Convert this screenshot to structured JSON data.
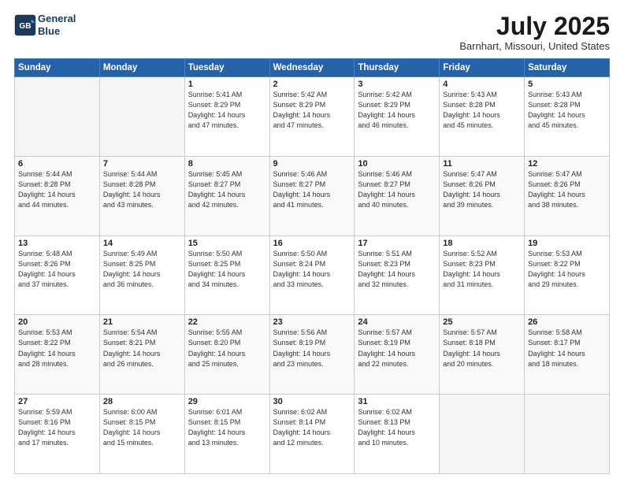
{
  "header": {
    "logo_line1": "General",
    "logo_line2": "Blue",
    "main_title": "July 2025",
    "subtitle": "Barnhart, Missouri, United States"
  },
  "weekdays": [
    "Sunday",
    "Monday",
    "Tuesday",
    "Wednesday",
    "Thursday",
    "Friday",
    "Saturday"
  ],
  "weeks": [
    [
      {
        "day": "",
        "empty": true
      },
      {
        "day": "",
        "empty": true
      },
      {
        "day": "1",
        "rise": "5:41 AM",
        "set": "8:29 PM",
        "daylight": "14 hours and 47 minutes."
      },
      {
        "day": "2",
        "rise": "5:42 AM",
        "set": "8:29 PM",
        "daylight": "14 hours and 47 minutes."
      },
      {
        "day": "3",
        "rise": "5:42 AM",
        "set": "8:29 PM",
        "daylight": "14 hours and 46 minutes."
      },
      {
        "day": "4",
        "rise": "5:43 AM",
        "set": "8:28 PM",
        "daylight": "14 hours and 45 minutes."
      },
      {
        "day": "5",
        "rise": "5:43 AM",
        "set": "8:28 PM",
        "daylight": "14 hours and 45 minutes."
      }
    ],
    [
      {
        "day": "6",
        "rise": "5:44 AM",
        "set": "8:28 PM",
        "daylight": "14 hours and 44 minutes."
      },
      {
        "day": "7",
        "rise": "5:44 AM",
        "set": "8:28 PM",
        "daylight": "14 hours and 43 minutes."
      },
      {
        "day": "8",
        "rise": "5:45 AM",
        "set": "8:27 PM",
        "daylight": "14 hours and 42 minutes."
      },
      {
        "day": "9",
        "rise": "5:46 AM",
        "set": "8:27 PM",
        "daylight": "14 hours and 41 minutes."
      },
      {
        "day": "10",
        "rise": "5:46 AM",
        "set": "8:27 PM",
        "daylight": "14 hours and 40 minutes."
      },
      {
        "day": "11",
        "rise": "5:47 AM",
        "set": "8:26 PM",
        "daylight": "14 hours and 39 minutes."
      },
      {
        "day": "12",
        "rise": "5:47 AM",
        "set": "8:26 PM",
        "daylight": "14 hours and 38 minutes."
      }
    ],
    [
      {
        "day": "13",
        "rise": "5:48 AM",
        "set": "8:26 PM",
        "daylight": "14 hours and 37 minutes."
      },
      {
        "day": "14",
        "rise": "5:49 AM",
        "set": "8:25 PM",
        "daylight": "14 hours and 36 minutes."
      },
      {
        "day": "15",
        "rise": "5:50 AM",
        "set": "8:25 PM",
        "daylight": "14 hours and 34 minutes."
      },
      {
        "day": "16",
        "rise": "5:50 AM",
        "set": "8:24 PM",
        "daylight": "14 hours and 33 minutes."
      },
      {
        "day": "17",
        "rise": "5:51 AM",
        "set": "8:23 PM",
        "daylight": "14 hours and 32 minutes."
      },
      {
        "day": "18",
        "rise": "5:52 AM",
        "set": "8:23 PM",
        "daylight": "14 hours and 31 minutes."
      },
      {
        "day": "19",
        "rise": "5:53 AM",
        "set": "8:22 PM",
        "daylight": "14 hours and 29 minutes."
      }
    ],
    [
      {
        "day": "20",
        "rise": "5:53 AM",
        "set": "8:22 PM",
        "daylight": "14 hours and 28 minutes."
      },
      {
        "day": "21",
        "rise": "5:54 AM",
        "set": "8:21 PM",
        "daylight": "14 hours and 26 minutes."
      },
      {
        "day": "22",
        "rise": "5:55 AM",
        "set": "8:20 PM",
        "daylight": "14 hours and 25 minutes."
      },
      {
        "day": "23",
        "rise": "5:56 AM",
        "set": "8:19 PM",
        "daylight": "14 hours and 23 minutes."
      },
      {
        "day": "24",
        "rise": "5:57 AM",
        "set": "8:19 PM",
        "daylight": "14 hours and 22 minutes."
      },
      {
        "day": "25",
        "rise": "5:57 AM",
        "set": "8:18 PM",
        "daylight": "14 hours and 20 minutes."
      },
      {
        "day": "26",
        "rise": "5:58 AM",
        "set": "8:17 PM",
        "daylight": "14 hours and 18 minutes."
      }
    ],
    [
      {
        "day": "27",
        "rise": "5:59 AM",
        "set": "8:16 PM",
        "daylight": "14 hours and 17 minutes."
      },
      {
        "day": "28",
        "rise": "6:00 AM",
        "set": "8:15 PM",
        "daylight": "14 hours and 15 minutes."
      },
      {
        "day": "29",
        "rise": "6:01 AM",
        "set": "8:15 PM",
        "daylight": "14 hours and 13 minutes."
      },
      {
        "day": "30",
        "rise": "6:02 AM",
        "set": "8:14 PM",
        "daylight": "14 hours and 12 minutes."
      },
      {
        "day": "31",
        "rise": "6:02 AM",
        "set": "8:13 PM",
        "daylight": "14 hours and 10 minutes."
      },
      {
        "day": "",
        "empty": true
      },
      {
        "day": "",
        "empty": true
      }
    ]
  ]
}
